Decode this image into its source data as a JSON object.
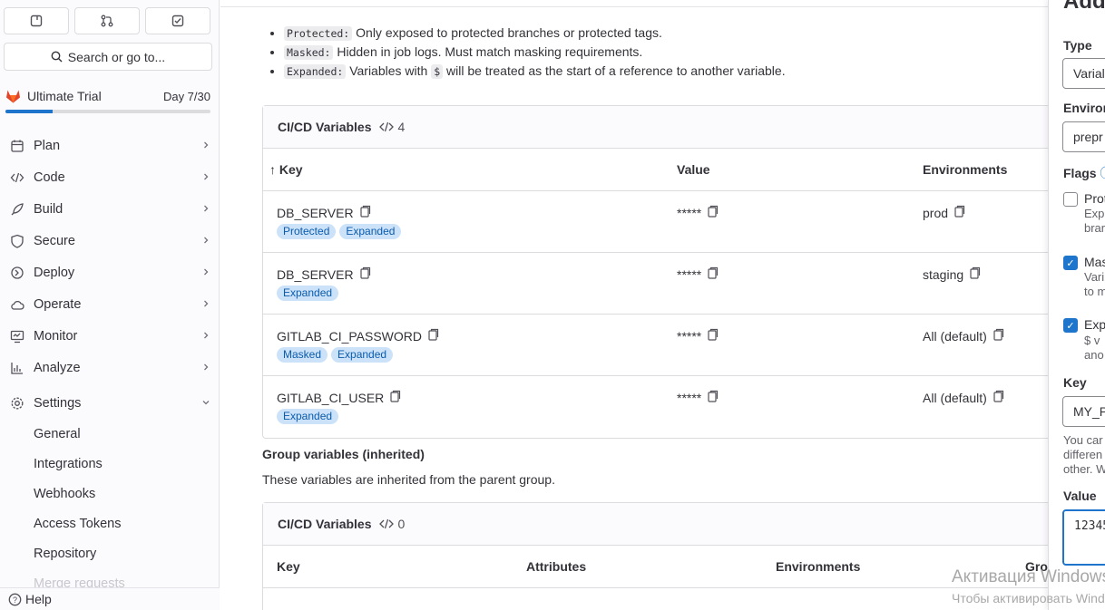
{
  "sidebar": {
    "search_label": "Search or go to...",
    "trial_title": "Ultimate Trial",
    "trial_day": "Day 7/30",
    "trial_progress": 0.23,
    "nav": [
      {
        "label": "Plan",
        "icon": "plan-icon",
        "chev": ">"
      },
      {
        "label": "Code",
        "icon": "code-icon",
        "chev": ">"
      },
      {
        "label": "Build",
        "icon": "rocket-icon",
        "chev": ">"
      },
      {
        "label": "Secure",
        "icon": "shield-icon",
        "chev": ">"
      },
      {
        "label": "Deploy",
        "icon": "deploy-icon",
        "chev": ">"
      },
      {
        "label": "Operate",
        "icon": "cloud-icon",
        "chev": ">"
      },
      {
        "label": "Monitor",
        "icon": "monitor-icon",
        "chev": ">"
      },
      {
        "label": "Analyze",
        "icon": "chart-icon",
        "chev": ">"
      },
      {
        "label": "Settings",
        "icon": "gear-icon",
        "chev": "v"
      }
    ],
    "settings_sub": [
      "General",
      "Integrations",
      "Webhooks",
      "Access Tokens",
      "Repository",
      "Merge requests"
    ],
    "help": "Help"
  },
  "info": {
    "items": [
      {
        "code": "Protected:",
        "text": "Only exposed to protected branches or protected tags."
      },
      {
        "code": "Masked:",
        "text": "Hidden in job logs. Must match masking requirements."
      },
      {
        "code": "Expanded:",
        "text_a": "Variables with",
        "code2": "$",
        "text_b": "will be treated as the start of a reference to another variable."
      }
    ]
  },
  "variables": {
    "title": "CI/CD Variables",
    "count": "4",
    "headers": {
      "key": "Key",
      "value": "Value",
      "env": "Environments"
    },
    "sort_arrow": "↑",
    "rows": [
      {
        "key": "DB_SERVER",
        "value": "*****",
        "env": "prod",
        "badges": [
          "Protected",
          "Expanded"
        ]
      },
      {
        "key": "DB_SERVER",
        "value": "*****",
        "env": "staging",
        "badges": [
          "Expanded"
        ]
      },
      {
        "key": "GITLAB_CI_PASSWORD",
        "value": "*****",
        "env": "All (default)",
        "badges": [
          "Masked",
          "Expanded"
        ]
      },
      {
        "key": "GITLAB_CI_USER",
        "value": "*****",
        "env": "All (default)",
        "badges": [
          "Expanded"
        ]
      }
    ]
  },
  "group": {
    "title": "Group variables (inherited)",
    "desc": "These variables are inherited from the parent group.",
    "card_title": "CI/CD Variables",
    "count": "0",
    "headers": {
      "key": "Key",
      "attributes": "Attributes",
      "env": "Environments",
      "group": "Grou"
    }
  },
  "drawer": {
    "title": "Add",
    "type_label": "Type",
    "type_value": "Varial",
    "env_label": "Environ",
    "env_value": "prepr",
    "flags_label": "Flags",
    "flag_protect": {
      "label": "Prot",
      "desc1": "Exp",
      "desc2": "brar",
      "checked": false
    },
    "flag_mask": {
      "label": "Mas",
      "desc1": "Vari",
      "desc2": "to m",
      "checked": true
    },
    "flag_expand": {
      "label": "Exp",
      "desc1": "$ v",
      "desc2": "ano",
      "checked": true
    },
    "key_label": "Key",
    "key_value": "MY_P",
    "key_help1": "You car",
    "key_help2": "differen",
    "key_help3": "other. W",
    "value_label": "Value",
    "value_value": "12345"
  },
  "watermark": {
    "line1": "Активация Windows",
    "line2": "Чтобы активировать Windows"
  },
  "colors": {
    "accent": "#1f75cb",
    "badge_bg": "#cbe2f9",
    "badge_text": "#0b5cad"
  }
}
